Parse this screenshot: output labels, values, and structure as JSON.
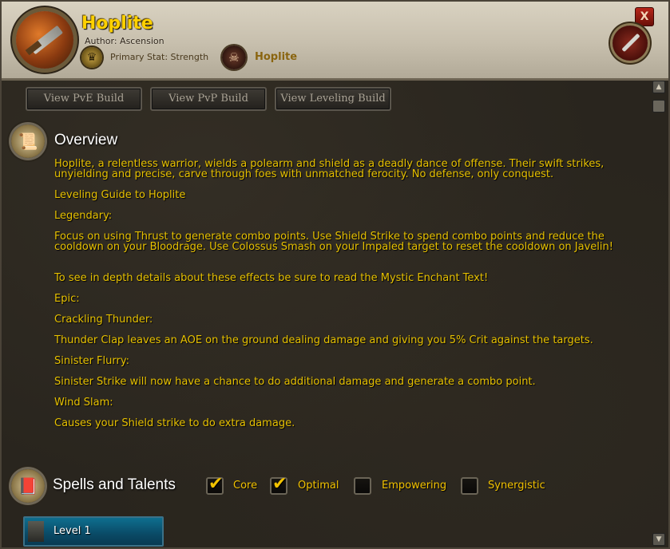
{
  "header": {
    "title": "Hoplite",
    "author": "Author: Ascension",
    "primary_stat": "Primary Stat: Strength",
    "class_name": "Hoplite",
    "close_label": "X"
  },
  "buttons": {
    "pve": "View PvE Build",
    "pvp": "View PvP Build",
    "leveling": "View Leveling Build"
  },
  "overview": {
    "title": "Overview",
    "paragraphs": [
      "Hoplite, a relentless warrior, wields a polearm and shield as a deadly dance of offense. Their swift strikes, unyielding and precise, carve through foes with unmatched ferocity. No defense, only conquest.",
      "Leveling Guide to Hoplite",
      "Legendary:",
      "Focus on using Thrust to generate combo points. Use Shield Strike to spend combo points and reduce the cooldown on your Bloodrage. Use Colossus Smash on your Impaled target to reset the cooldown on Javelin!",
      "To see in depth details about these effects be sure to read the Mystic Enchant Text!",
      "Epic:",
      "Crackling Thunder:",
      "Thunder Clap leaves an AOE on the ground dealing damage and giving you 5% Crit against the targets.",
      "Sinister Flurry:",
      "Sinister Strike will now have a chance to do additional damage and generate a combo point.",
      "Wind Slam:",
      "Causes your Shield strike to do extra damage."
    ]
  },
  "spells": {
    "title": "Spells and Talents",
    "filters": [
      {
        "label": "Core",
        "checked": true
      },
      {
        "label": "Optimal",
        "checked": true
      },
      {
        "label": "Empowering",
        "checked": false
      },
      {
        "label": "Synergistic",
        "checked": false
      }
    ],
    "level_label": "Level 1"
  },
  "icons": {
    "portrait": "polearm-portrait-icon",
    "stat": "strength-stat-icon",
    "class": "hoplite-class-icon",
    "weapon": "sword-icon",
    "overview": "scroll-icon",
    "spells": "spellbook-icon"
  },
  "colors": {
    "title": "#ffd100",
    "text": "#e6c000",
    "level_bar": "#0e6f8f"
  }
}
